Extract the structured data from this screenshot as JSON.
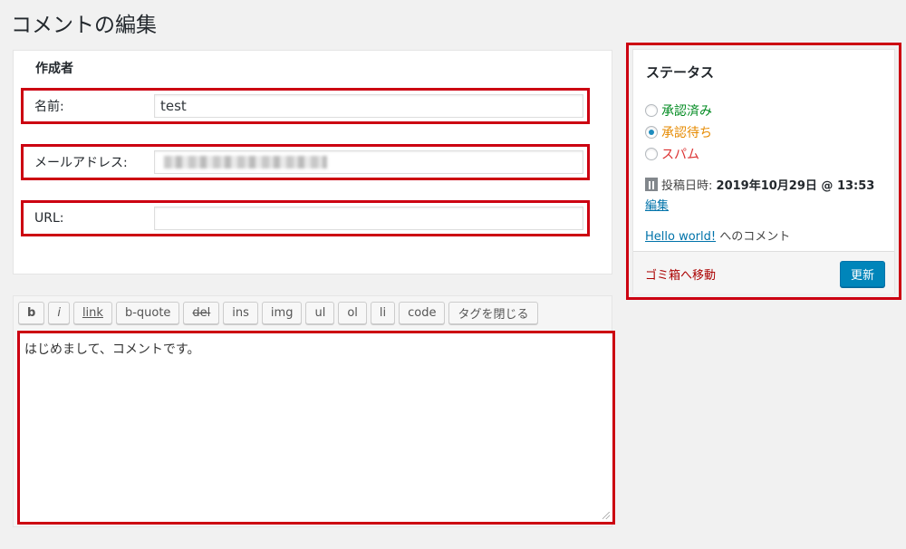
{
  "page": {
    "title": "コメントの編集"
  },
  "author": {
    "heading": "作成者",
    "name_label": "名前:",
    "name_value": "test",
    "email_label": "メールアドレス:",
    "url_label": "URL:",
    "url_value": ""
  },
  "editor": {
    "buttons": [
      "b",
      "i",
      "link",
      "b-quote",
      "del",
      "ins",
      "img",
      "ul",
      "ol",
      "li",
      "code",
      "タグを閉じる"
    ],
    "content": "はじめまして、コメントです。"
  },
  "status": {
    "heading": "ステータス",
    "options": [
      "承認済み",
      "承認待ち",
      "スパム"
    ],
    "selected": "承認待ち",
    "date_label": "投稿日時:",
    "date_value": "2019年10月29日 @ 13:53",
    "edit_link": "編集",
    "post_link": "Hello world!",
    "post_suffix": "へのコメント",
    "trash_link": "ゴミ箱へ移動",
    "update_button": "更新"
  },
  "colors": {
    "highlight_border": "#cc0011",
    "approved": "#008a20",
    "pending": "#e68a00",
    "spam": "#dc3232",
    "primary_button": "#0085ba",
    "link": "#0073aa"
  },
  "icons": {
    "calendar": "calendar-icon",
    "radio": "radio-button"
  }
}
